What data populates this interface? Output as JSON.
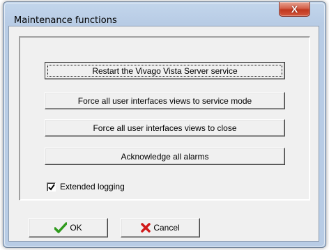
{
  "window": {
    "title": "Maintenance functions",
    "close_glyph": "X"
  },
  "actions": {
    "restart_label": "Restart the Vivago Vista Server service",
    "service_mode_label": "Force all user interfaces views to service mode",
    "close_views_label": "Force all user interfaces views to close",
    "ack_alarms_label": "Acknowledge all alarms"
  },
  "options": {
    "extended_logging_label": "Extended logging",
    "extended_logging_checked": true
  },
  "footer": {
    "ok_label": "OK",
    "cancel_label": "Cancel",
    "ok_icon": "green-checkmark-icon",
    "cancel_icon": "red-x-icon"
  },
  "colors": {
    "ok_check": "#2e9a1c",
    "cancel_x": "#d11a1a",
    "close_button": "#c1381f"
  }
}
